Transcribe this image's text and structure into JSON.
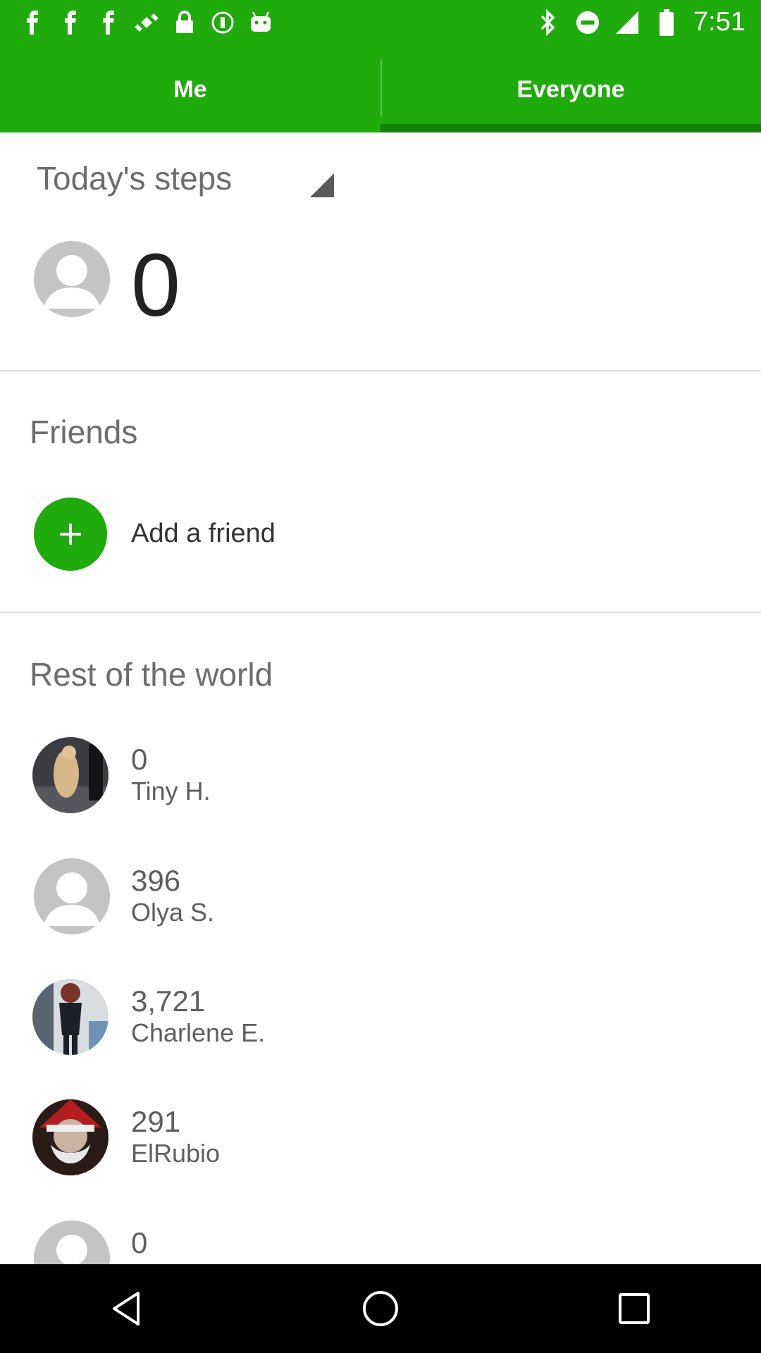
{
  "status_bar": {
    "time": "7:51",
    "left_icons": [
      "fb-icon",
      "fb-icon",
      "fb-icon",
      "fake-gps-icon",
      "lock-icon",
      "circle-icon",
      "android-icon"
    ],
    "right_icons": [
      "bluetooth-icon",
      "dnd-icon",
      "signal-icon",
      "battery-icon"
    ]
  },
  "tabs": [
    {
      "label": "Me",
      "active": false
    },
    {
      "label": "Everyone",
      "active": true
    }
  ],
  "today": {
    "title": "Today's steps",
    "steps": "0"
  },
  "friends": {
    "title": "Friends",
    "add_label": "Add a friend"
  },
  "world": {
    "title": "Rest of the world",
    "rows": [
      {
        "value": "0",
        "name": "Tiny H."
      },
      {
        "value": "396",
        "name": "Olya S."
      },
      {
        "value": "3,721",
        "name": "Charlene E."
      },
      {
        "value": "291",
        "name": "ElRubio"
      },
      {
        "value": "0",
        "name": ""
      }
    ]
  },
  "colors": {
    "accent": "#1eab0b",
    "tab_indicator": "#138007"
  }
}
